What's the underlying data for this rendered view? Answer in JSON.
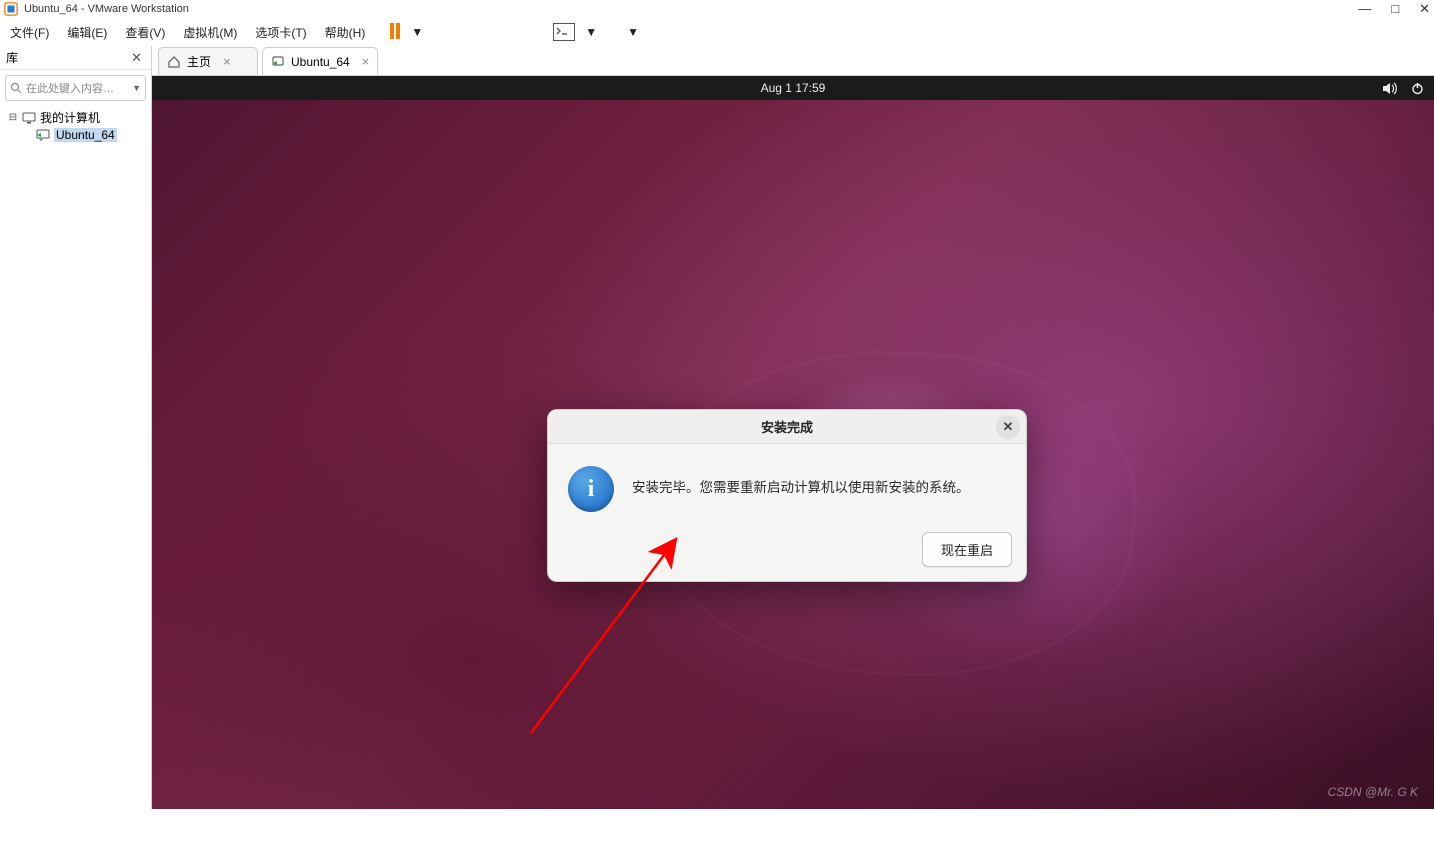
{
  "window": {
    "title": "Ubuntu_64 - VMware Workstation"
  },
  "menubar": {
    "items": [
      "文件(F)",
      "编辑(E)",
      "查看(V)",
      "虚拟机(M)",
      "选项卡(T)",
      "帮助(H)"
    ]
  },
  "sidebar": {
    "title": "库",
    "search_placeholder": "在此处键入内容…",
    "tree": {
      "root_label": "我的计算机",
      "vm_label": "Ubuntu_64"
    }
  },
  "tabs": {
    "home_label": "主页",
    "vm_label": "Ubuntu_64"
  },
  "gnome": {
    "clock": "Aug 1  17:59"
  },
  "dialog": {
    "title": "安装完成",
    "message": "安装完毕。您需要重新启动计算机以使用新安装的系统。",
    "restart_label": "现在重启"
  },
  "watermark": "CSDN @Mr. G K"
}
